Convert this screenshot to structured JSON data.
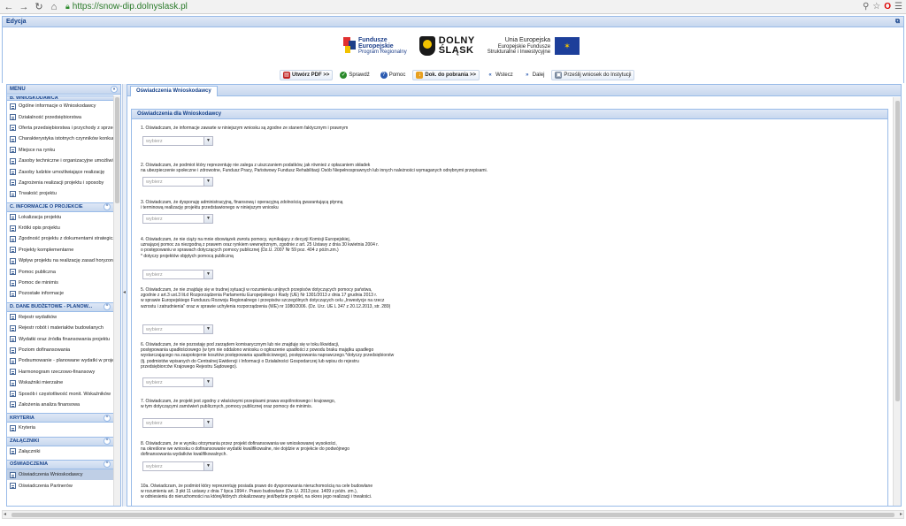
{
  "browser": {
    "url": "https://snow-dip.dolnyslask.pl",
    "nav_icons": [
      "back-arrow-icon",
      "forward-arrow-icon",
      "reload-icon",
      "home-icon",
      "lock-icon"
    ],
    "right_icons": [
      "pin-icon",
      "star-icon",
      "opera-icon",
      "menu-icon"
    ]
  },
  "app": {
    "title": "Edycja",
    "title_icon": "restore-icon"
  },
  "logos": {
    "fe_line1": "Fundusze",
    "fe_line2": "Europejskie",
    "fe_line3": "Program Regionalny",
    "ds_line1": "DOLNY",
    "ds_line2": "ŚLĄSK",
    "eu_line1": "Unia Europejska",
    "eu_line2": "Europejskie Fundusze",
    "eu_line3": "Strukturalne i Inwestycyjne"
  },
  "toolbar": {
    "create_pdf": "Utwórz PDF >>",
    "check": "Sprawdź",
    "help": "Pomoc",
    "downloads": "Dok. do pobrania >>",
    "back": "Wstecz",
    "next": "Dalej",
    "send": "Prześlij wniosek do Instytucji"
  },
  "sidebar": {
    "menu_title": "MENU",
    "sections": [
      {
        "title": "B. WNIOSKODAWCA",
        "items": [
          "Ogólne informacje o Wnioskodawcy",
          "Działalność przedsiębiorstwa",
          "Oferta przedsiębiorstwa i przychody z sprzedaży",
          "Charakterystyka istotnych czynników konkurencyjności",
          "Miejsce na rynku",
          "Zasoby techniczne i organizacyjne umożliwiające",
          "Zasoby ludzkie umożliwiające realizację",
          "Zagrożenia realizacji projektu i sposoby",
          "Trwałość projektu"
        ]
      },
      {
        "title": "C. INFORMACJE O PROJEKCIE",
        "items": [
          "Lokalizacja projektu",
          "Krótki opis projektu",
          "Zgodność projektu z dokumentami strategicznymi",
          "Projekty komplementarne",
          "Wpływ projektu na realizację zasad horyzontalnych",
          "Pomoc publiczna",
          "Pomoc de minimis",
          "Pozostałe informacje"
        ]
      },
      {
        "title": "D. DANE BUDŻETOWE - PLANOW...",
        "items": [
          "Rejestr wydatków",
          "Rejestr robót i materiałów budowlanych",
          "Wydatki oraz źródła finansowania projektu",
          "Poziom dofinansowania",
          "Podsumowanie - planowane wydatki w projekcie",
          "Harmonogram rzeczowo-finansowy",
          "Wskaźniki mierzalne",
          "Sposób i częstotliwość monit. Wskaźników",
          "Założenia analiza finansowa"
        ]
      },
      {
        "title": "KRYTERIA",
        "items": [
          "Kryteria"
        ]
      },
      {
        "title": "ZAŁĄCZNIKI",
        "items": [
          "Załączniki"
        ]
      },
      {
        "title": "OŚWIADCZENIA",
        "items": [
          "Oświadczenia Wnioskodawcy",
          "Oświadczenia Partnerów"
        ]
      }
    ],
    "active_item": "Oświadczenia Wnioskodawcy"
  },
  "main": {
    "tab": "Oświadczenia Wnioskodawcy",
    "panel_title": "Oświadczenia dla Wnioskodawcy",
    "dropdown_placeholder": "wybierz",
    "statements": [
      "1. Oświadczam, że informacje zawarte w niniejszym wniosku są zgodne ze stanem faktycznym i prawnym",
      "2. Oświadczam, że podmiot który reprezentuję nie zalega z uiszczaniem podatków, jak również z opłacaniem składek\nna ubezpieczenie społeczne i zdrowotne, Fundusz Pracy, Państwowy Fundusz Rehabilitacji Osób Niepełnosprawnych lub innych należności wymaganych odrębnymi przepisami.",
      "3. Oświadczam, że dysponuję administracyjną, finansową i operacyjną zdolnością gwarantującą płynną\ni terminową realizację projektu przedstawionego w niniejszym wniosku",
      "4. Oświadczam, że nie ciąży na mnie obowiązek zwrotu pomocy, wynikający z decyzji Komisji Europejskiej,\nuznającej pomoc za niezgodną z prawem oraz rynkiem wewnętrznym, zgodnie z art. 25 Ustawy z dnia 30 kwietnia 2004 r.\no postępowaniu w sprawach dotyczących pomocy publicznej (Dz.U. 2007 Nr 59 poz. 404 z późn.zm.)\n* dotyczy projektów objętych pomocą publiczną",
      "5. Oświadczam, że nie znajduję się w trudnej sytuacji w rozumieniu unijnych przepisów dotyczących pomocy państwa,\nzgodnie z art.3 ust.3 lit.d Rozporządzenia Parlamentu Europejskiego i Rady (UE) Nr 1301/2013 z dnia 17 grudnia 2013 r.\nw sprawie Europejskiego Funduszu Rozwoju Regionalnego i przepisów szczególnych dotyczących celu „Inwestycje na rzecz\nwzrostu i zatrudnienia\" oraz w sprawie uchylenia rozporządzenia (WE) nr 1080/2006. (Dz. Urz. UE L 347 z 20.12.2013, str. 289)",
      "6. Oświadczam, że nie pozostaję pod zarządem komisarycznym lub nie znajduję się w toku likwidacji,\npostępowania upadłościowego (w tym nie oddalono wniosku o ogłoszenie upadłości z powodu braku majątku upadłego\nwystarczającego na zaspokojenie kosztów postępowania upadłościowego), postępowania naprawczego.*dotyczy przedsiębiorstw\n(tj. podmiotów wpisanych do Centralnej Ewidencji i Informacji o Działalności Gospodarczej lub wpisu do rejestru\nprzedsiębiorców Krajowego Rejestru Sądowego).",
      "7. Oświadczam, że projekt jest zgodny z właściwymi przepisami prawa wspólnotowego i krajowego,\nw tym dotyczącymi zamówień publicznych, pomocy publicznej oraz pomocy de minimis.",
      "8. Oświadczam, że w wyniku otrzymania przez projekt dofinansowania we wnioskowanej wysokości,\nna określone we wniosku o dofinansowanie wydatki kwalifikowalne, nie dojdzie w projekcie do podwójnego\ndofinansowania wydatków kwalifikowalnych.",
      "10a. Oświadczam, że podmiot który reprezentuję posiada prawo do dysponowania nieruchomością na cele budowlane\nw rozumieniu art. 3 pkt 11 ustawy z dnia 7 lipca 1994 r. Prawo budowlane (Dz. U. 2013 poz. 1409 z późn. zm.),\nw odniesieniu do nieruchomości na której/których zlokalizowany jest/będzie projekt, na okres jego realizacji i trwałości."
    ]
  }
}
